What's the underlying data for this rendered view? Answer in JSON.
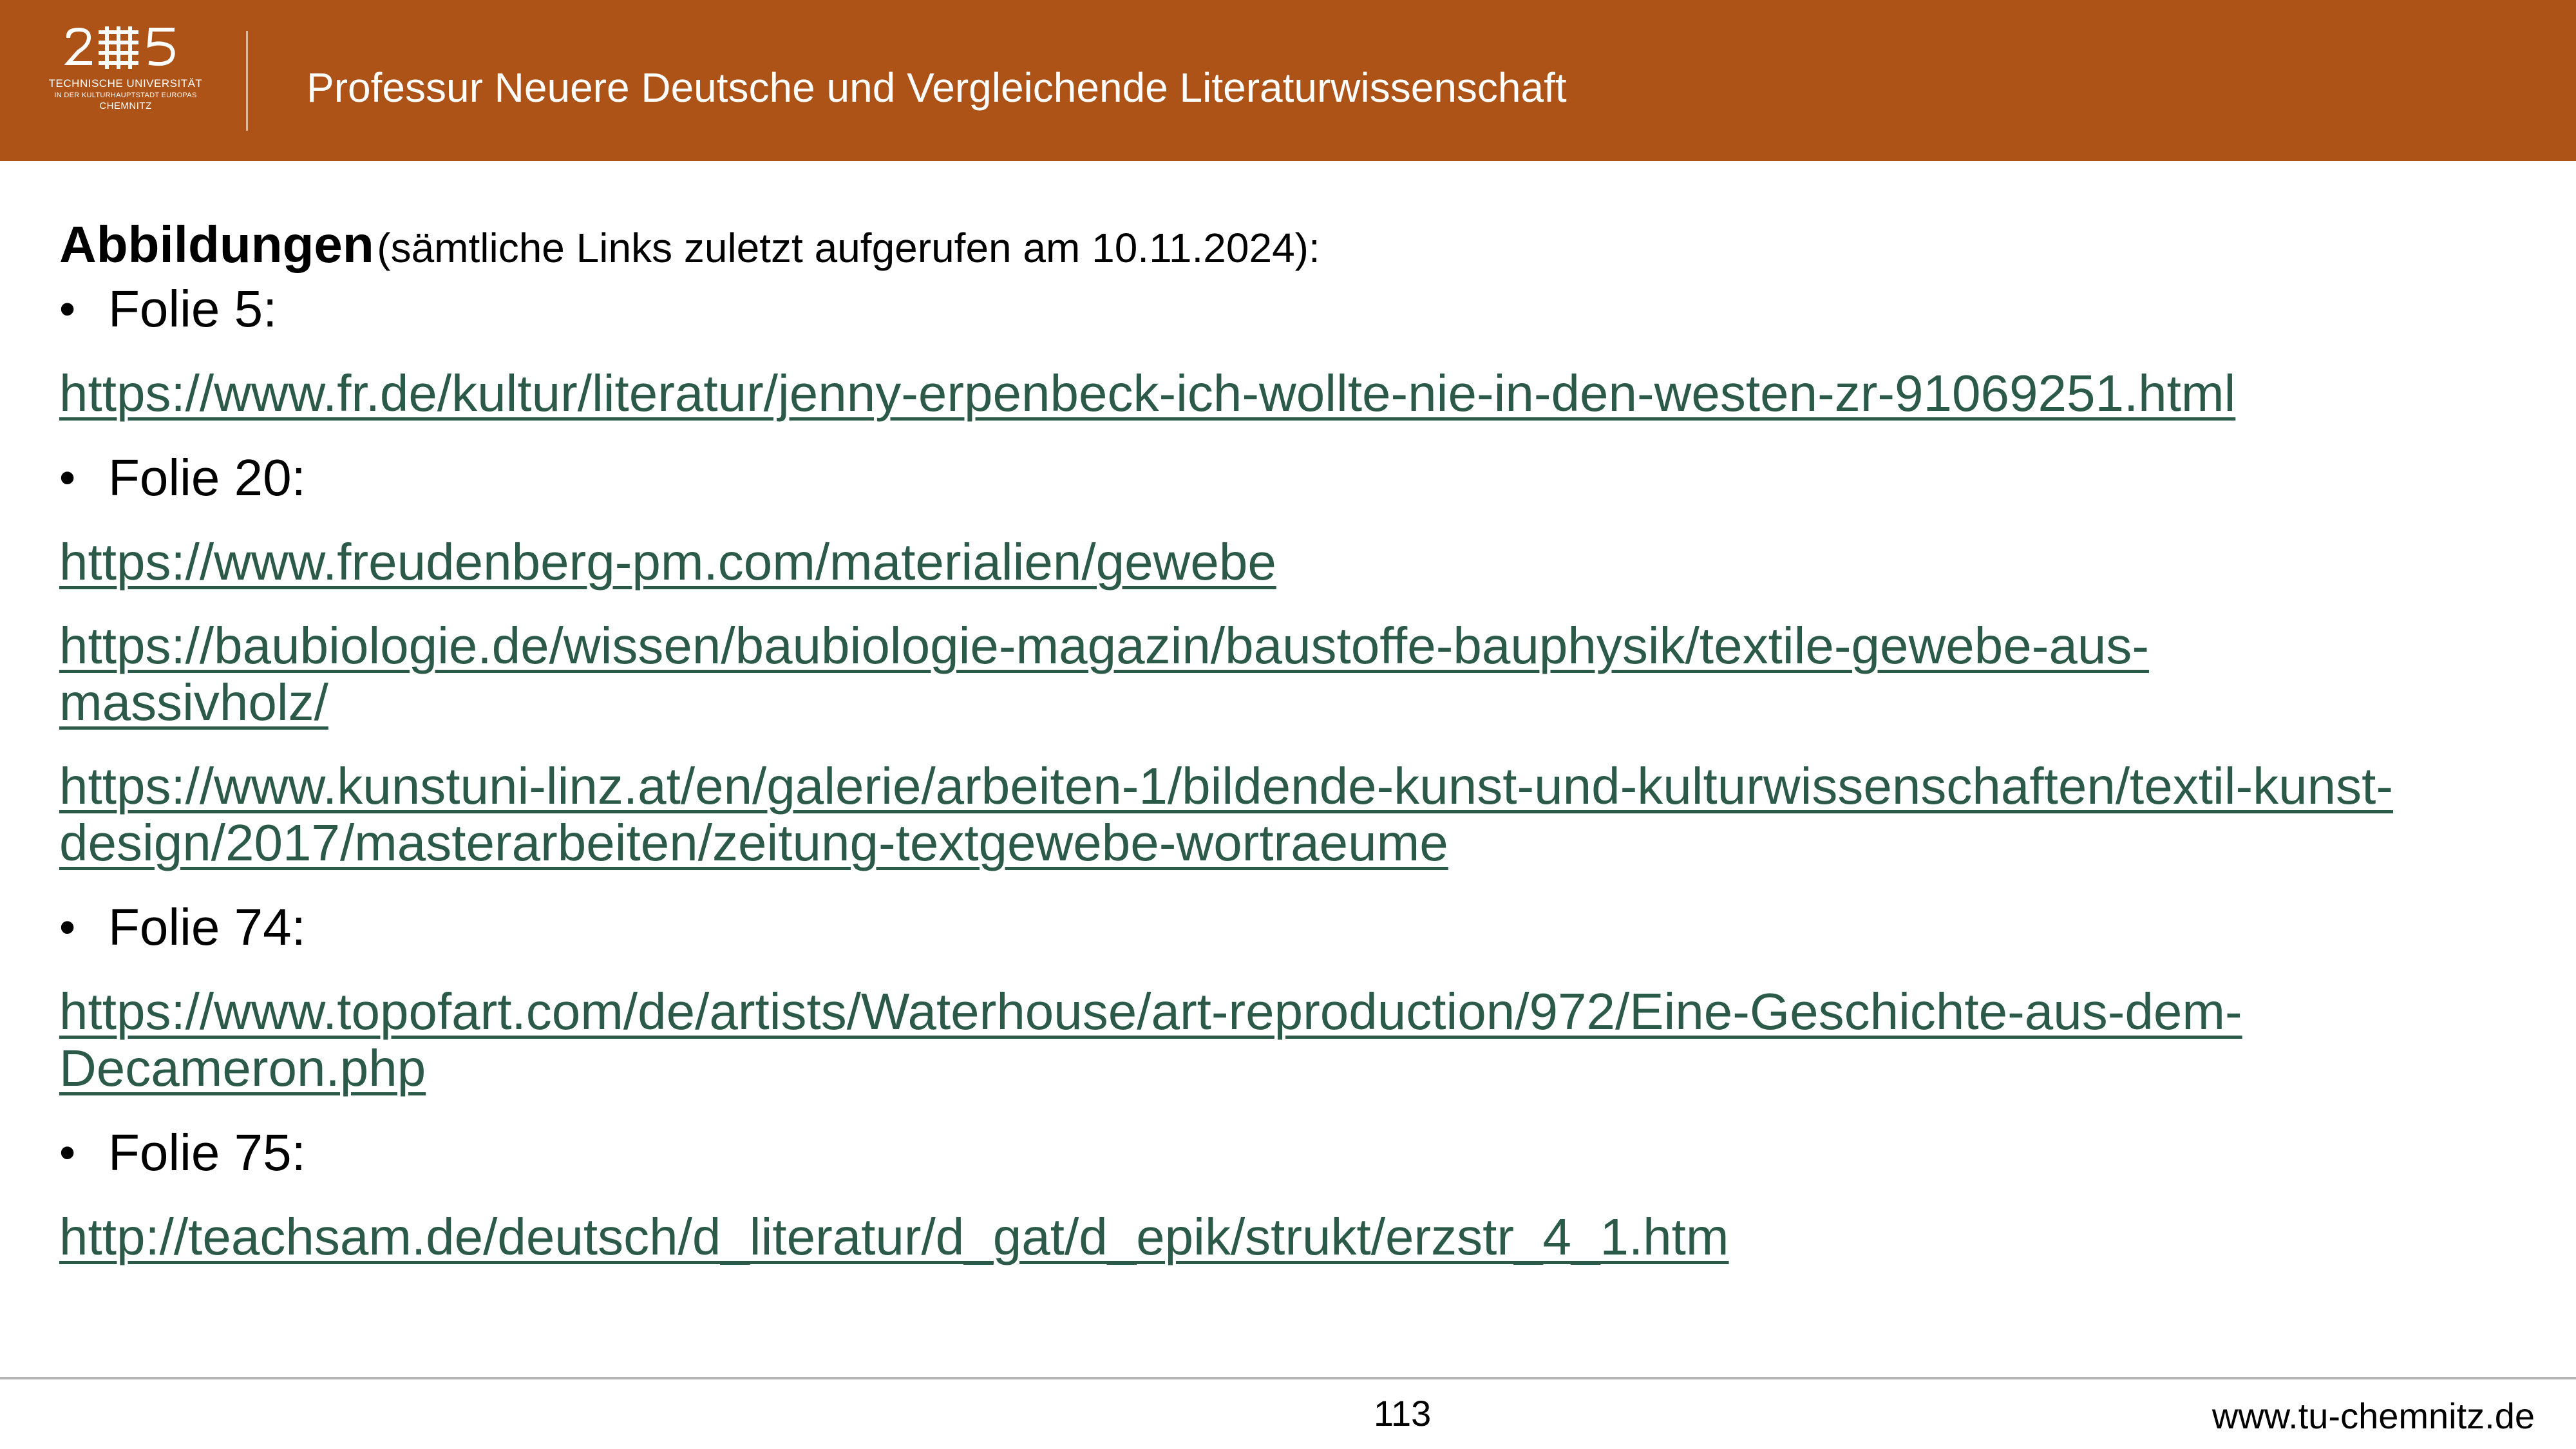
{
  "header": {
    "logo": {
      "line1": "TECHNISCHE UNIVERSITÄT",
      "line2": "IN DER KULTURHAUPTSTADT EUROPAS",
      "line3": "CHEMNITZ"
    },
    "title": "Professur Neuere Deutsche und Vergleichende Literaturwissenschaft"
  },
  "content": {
    "heading": "Abbildungen",
    "heading_note": "(sämtliche Links zuletzt aufgerufen am 10.11.2024):",
    "bullet_symbol": "•",
    "sections": [
      {
        "label": "Folie 5:",
        "links": [
          [
            "https://www.fr.de/kultur/literatur/jenny-erpenbeck-ich-wollte-nie-in-den-westen-zr-91069251.html"
          ]
        ]
      },
      {
        "label": "Folie 20:",
        "links": [
          [
            "https://www.freudenberg-pm.com/materialien/gewebe"
          ],
          [
            "https://baubiologie.de/wissen/baubiologie-magazin/baustoffe-bauphysik/textile-gewebe-aus-",
            "massivholz/"
          ],
          [
            "https://www.kunstuni-linz.at/en/galerie/arbeiten-1/bildende-kunst-und-kulturwissenschaften/textil-kunst-",
            "design/2017/masterarbeiten/zeitung-textgewebe-wortraeume"
          ]
        ]
      },
      {
        "label": "Folie 74:",
        "links": [
          [
            "https://www.topofart.com/de/artists/Waterhouse/art-reproduction/972/Eine-Geschichte-aus-dem-",
            "Decameron.php"
          ]
        ]
      },
      {
        "label": "Folie 75:",
        "links": [
          [
            "http://teachsam.de/deutsch/d_literatur/d_gat/d_epik/strukt/erzstr_4_1.htm"
          ]
        ]
      }
    ]
  },
  "footer": {
    "page_number": "113",
    "url": "www.tu-chemnitz.de"
  },
  "colors": {
    "header_bg": "#ad5318",
    "link": "#2c5a48"
  }
}
